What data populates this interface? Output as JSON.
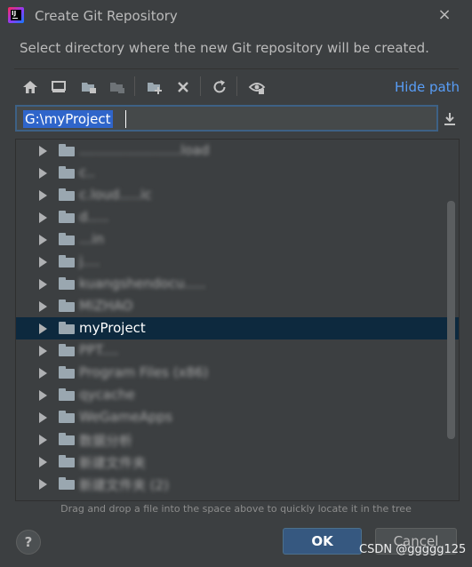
{
  "window": {
    "title": "Create Git Repository",
    "close_glyph": "×"
  },
  "instruction": "Select directory where the new Git repository will be created.",
  "toolbar": {
    "icons": [
      "home-icon",
      "desktop-icon",
      "project-folder-icon",
      "module-folder-icon",
      "new-folder-icon",
      "delete-icon",
      "refresh-icon",
      "show-hidden-icon"
    ],
    "hide_path_label": "Hide path"
  },
  "path_field": {
    "value": "G:\\myProject"
  },
  "tree": {
    "items": [
      {
        "label": "........................load",
        "blurred": true,
        "selected": false
      },
      {
        "label": "c..",
        "blurred": true,
        "selected": false
      },
      {
        "label": "c.loud.....ic",
        "blurred": true,
        "selected": false
      },
      {
        "label": "d.....",
        "blurred": true,
        "selected": false
      },
      {
        "label": "...in",
        "blurred": true,
        "selected": false
      },
      {
        "label": "j....",
        "blurred": true,
        "selected": false
      },
      {
        "label": "kuangshendocu.....",
        "blurred": true,
        "selected": false
      },
      {
        "label": "MiZHAO",
        "blurred": true,
        "selected": false
      },
      {
        "label": "myProject",
        "blurred": false,
        "selected": true
      },
      {
        "label": "PPT....",
        "blurred": true,
        "selected": false
      },
      {
        "label": "Program Files (x86)",
        "blurred": true,
        "selected": false
      },
      {
        "label": "qycache",
        "blurred": true,
        "selected": false
      },
      {
        "label": "WeGameApps",
        "blurred": true,
        "selected": false
      },
      {
        "label": "数据分析",
        "blurred": true,
        "selected": false
      },
      {
        "label": "新建文件夹",
        "blurred": true,
        "selected": false
      },
      {
        "label": "新建文件夹 (2)",
        "blurred": true,
        "selected": false
      }
    ]
  },
  "hint": "Drag and drop a file into the space above to quickly locate it in the tree",
  "footer": {
    "help_label": "?",
    "ok_label": "OK",
    "cancel_label": "Cancel",
    "watermark": "CSDN @ggggg125"
  },
  "colors": {
    "background": "#3c3f41",
    "accent_link": "#589df6",
    "selection": "#0d293e",
    "ok_button": "#365880"
  }
}
